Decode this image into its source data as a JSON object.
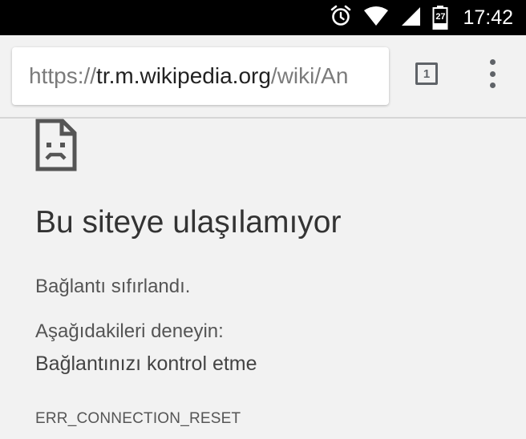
{
  "status_bar": {
    "time": "17:42",
    "battery_level": "27",
    "icons": [
      "alarm-icon",
      "wifi-icon",
      "cell-signal-icon",
      "battery-icon"
    ]
  },
  "toolbar": {
    "url_scheme": "https://",
    "url_host": "tr.m.wikipedia.org",
    "url_path": "/wiki/An",
    "tab_count": "1",
    "menu_icon": "overflow-menu-icon"
  },
  "error_page": {
    "icon": "sad-page-icon",
    "title": "Bu siteye ulaşılamıyor",
    "message": "Bağlantı sıfırlandı.",
    "suggestions_header": "Aşağıdakileri deneyin:",
    "suggestion": "Bağlantınızı kontrol etme",
    "error_code": "ERR_CONNECTION_RESET"
  },
  "colors": {
    "status_bar_bg": "#000000",
    "page_bg": "#f2f2f2",
    "omnibox_bg": "#ffffff",
    "icon_gray": "#5f6368"
  }
}
